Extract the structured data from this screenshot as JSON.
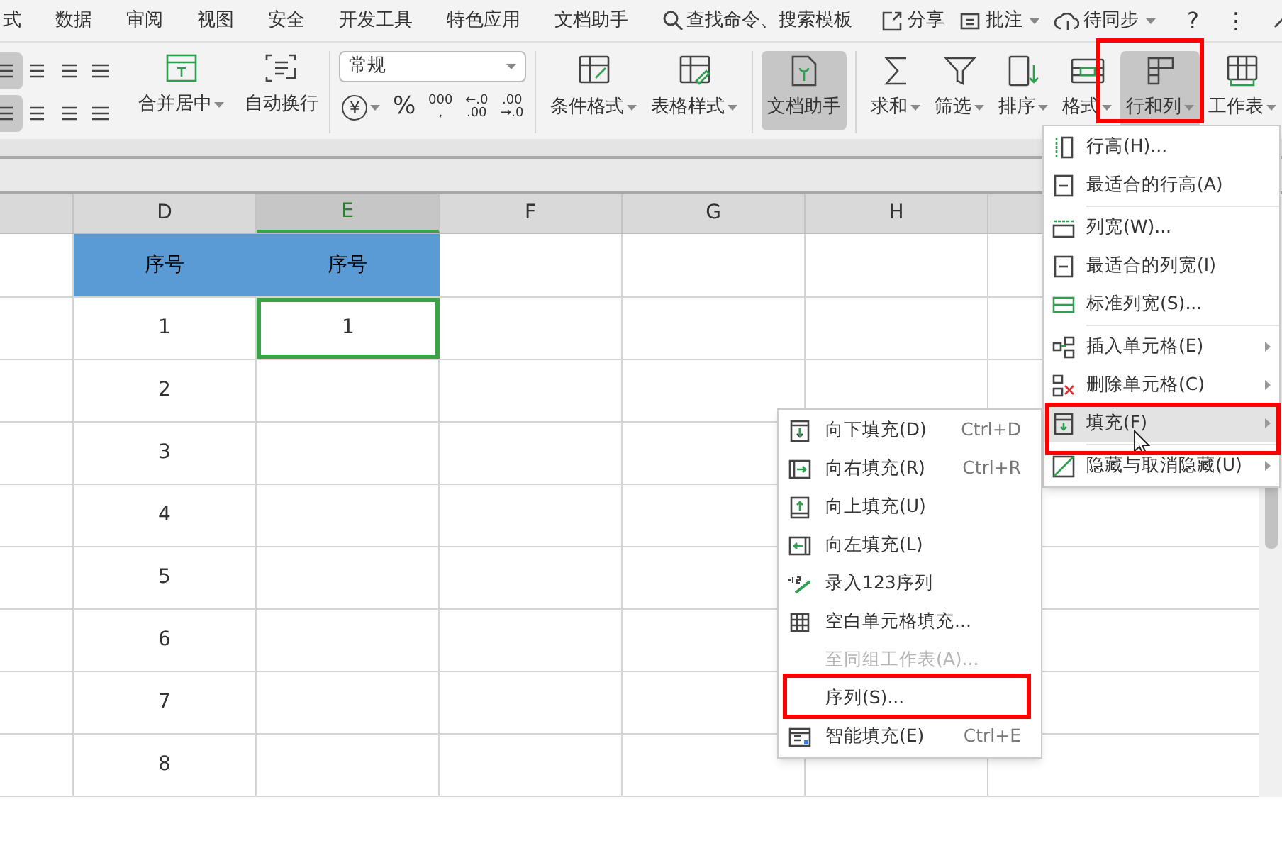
{
  "menu_tabs": [
    {
      "label": "式"
    },
    {
      "label": "数据"
    },
    {
      "label": "审阅"
    },
    {
      "label": "视图"
    },
    {
      "label": "安全"
    },
    {
      "label": "开发工具"
    },
    {
      "label": "特色应用"
    },
    {
      "label": "文档助手"
    }
  ],
  "search": {
    "label": "查找命令、搜索模板"
  },
  "top_actions": [
    {
      "label": "分享",
      "dropdown": false
    },
    {
      "label": "批注",
      "dropdown": true
    },
    {
      "label": "待同步",
      "dropdown": true
    }
  ],
  "window_controls": [
    {
      "label": "?"
    },
    {
      "label": "⋮"
    }
  ],
  "merge_buttons": [
    {
      "label": "合并居中",
      "dropdown": true
    },
    {
      "label": "自动换行",
      "dropdown": false
    }
  ],
  "number_format": {
    "value": "常规"
  },
  "number_buttons": [
    {
      "kind": "currency",
      "label": "¥",
      "dropdown": true
    },
    {
      "kind": "plain",
      "label": "%"
    },
    {
      "kind": "stack",
      "lines": [
        "000",
        ","
      ]
    },
    {
      "kind": "stack",
      "lines": [
        "←.0",
        ".00"
      ]
    },
    {
      "kind": "stack",
      "lines": [
        ".00",
        "→.0"
      ]
    }
  ],
  "tool_groups": [
    {
      "buttons": [
        {
          "label": "条件格式",
          "dropdown": true,
          "selected": false
        },
        {
          "label": "表格样式",
          "dropdown": true,
          "selected": false
        }
      ]
    },
    {
      "buttons": [
        {
          "label": "文档助手",
          "dropdown": false,
          "selected": true
        }
      ]
    },
    {
      "buttons": [
        {
          "label": "求和",
          "dropdown": true,
          "selected": false
        },
        {
          "label": "筛选",
          "dropdown": true,
          "selected": false
        },
        {
          "label": "排序",
          "dropdown": true,
          "selected": false
        },
        {
          "label": "格式",
          "dropdown": true,
          "selected": false
        },
        {
          "label": "行和列",
          "dropdown": true,
          "selected": true
        },
        {
          "label": "工作表",
          "dropdown": true,
          "selected": false
        }
      ]
    }
  ],
  "columns": [
    {
      "label": "D",
      "selected": false
    },
    {
      "label": "E",
      "selected": true
    },
    {
      "label": "F",
      "selected": false
    },
    {
      "label": "G",
      "selected": false
    },
    {
      "label": "H",
      "selected": false
    }
  ],
  "rows": [
    {
      "kind": "header",
      "cells": [
        {
          "text": "序号",
          "selected": false
        },
        {
          "text": "序号",
          "selected": false
        }
      ]
    },
    {
      "kind": "data",
      "cells": [
        {
          "text": "1",
          "selected": false
        },
        {
          "text": "1",
          "selected": true
        }
      ]
    },
    {
      "kind": "data",
      "cells": [
        {
          "text": "2",
          "selected": false
        }
      ]
    },
    {
      "kind": "data",
      "cells": [
        {
          "text": "3",
          "selected": false
        }
      ]
    },
    {
      "kind": "data",
      "cells": [
        {
          "text": "4",
          "selected": false
        }
      ]
    },
    {
      "kind": "data",
      "cells": [
        {
          "text": "5",
          "selected": false
        }
      ]
    },
    {
      "kind": "data",
      "cells": [
        {
          "text": "6",
          "selected": false
        }
      ]
    },
    {
      "kind": "data",
      "cells": [
        {
          "text": "7",
          "selected": false
        }
      ]
    },
    {
      "kind": "data",
      "cells": [
        {
          "text": "8",
          "selected": false
        }
      ]
    }
  ],
  "row_col_menu": [
    {
      "kind": "item",
      "label": "行高(H)...",
      "submenu": false,
      "selected": false
    },
    {
      "kind": "item",
      "label": "最适合的行高(A)",
      "submenu": false,
      "selected": false
    },
    {
      "kind": "separator"
    },
    {
      "kind": "item",
      "label": "列宽(W)...",
      "submenu": false,
      "selected": false
    },
    {
      "kind": "item",
      "label": "最适合的列宽(I)",
      "submenu": false,
      "selected": false
    },
    {
      "kind": "item",
      "label": "标准列宽(S)...",
      "submenu": false,
      "selected": false
    },
    {
      "kind": "separator"
    },
    {
      "kind": "item",
      "label": "插入单元格(E)",
      "submenu": true,
      "selected": false
    },
    {
      "kind": "item",
      "label": "删除单元格(C)",
      "submenu": true,
      "selected": false
    },
    {
      "kind": "item",
      "label": "填充(F)",
      "submenu": true,
      "selected": true
    },
    {
      "kind": "separator"
    },
    {
      "kind": "item",
      "label": "隐藏与取消隐藏(U)",
      "submenu": true,
      "selected": false
    }
  ],
  "fill_menu": [
    {
      "label": "向下填充(D)",
      "shortcut": "Ctrl+D",
      "disabled": false
    },
    {
      "label": "向右填充(R)",
      "shortcut": "Ctrl+R",
      "disabled": false
    },
    {
      "label": "向上填充(U)",
      "disabled": false
    },
    {
      "label": "向左填充(L)",
      "disabled": false
    },
    {
      "label": "录入123序列",
      "disabled": false
    },
    {
      "label": "空白单元格填充...",
      "disabled": false
    },
    {
      "label": "至同组工作表(A)...",
      "disabled": true
    },
    {
      "label": "序列(S)...",
      "disabled": false
    },
    {
      "label": "智能填充(E)",
      "shortcut": "Ctrl+E",
      "disabled": false
    }
  ]
}
